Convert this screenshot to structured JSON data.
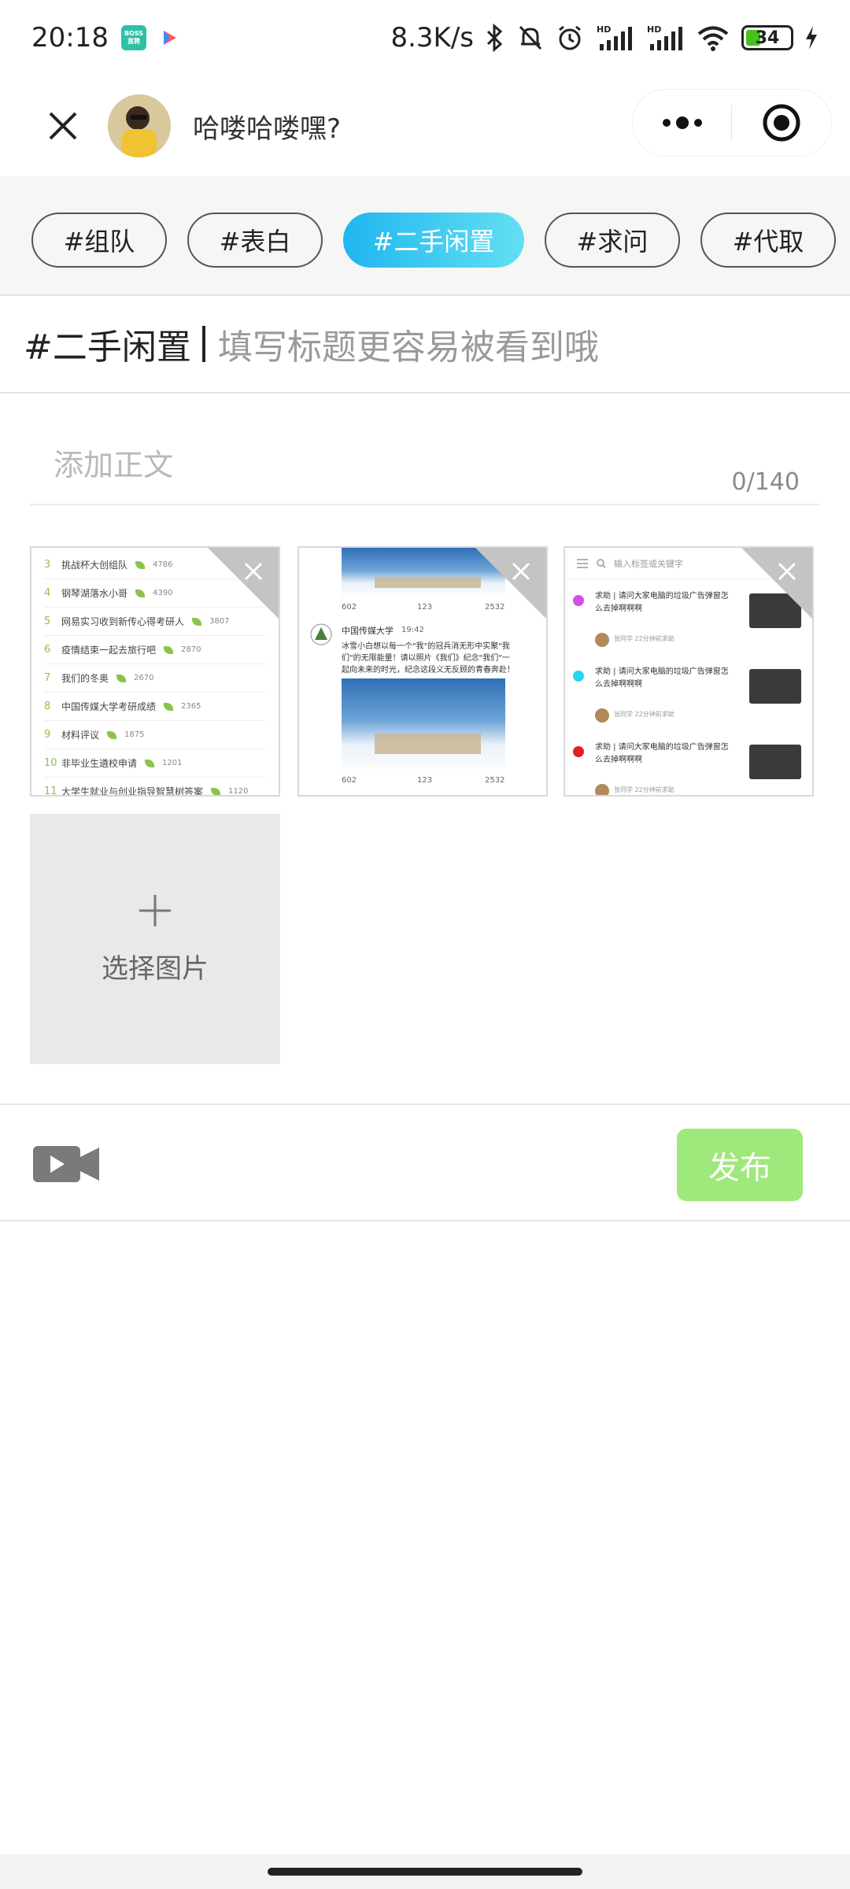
{
  "status_bar": {
    "time": "20:18",
    "boss_badge_top": "BOSS",
    "boss_badge_bottom": "直聘",
    "net_speed": "8.3K/s",
    "battery": "34",
    "icons": [
      "boss-app-icon",
      "play-icon",
      "bluetooth-icon",
      "mute-bell-icon",
      "alarm-icon",
      "hd-signal-icon",
      "hd-signal-icon",
      "wifi-icon",
      "battery-icon",
      "charging-icon"
    ]
  },
  "header": {
    "title": "哈喽哈喽嘿?"
  },
  "tags": [
    {
      "label": "#组队",
      "active": false
    },
    {
      "label": "#表白",
      "active": false
    },
    {
      "label": "#二手闲置",
      "active": true
    },
    {
      "label": "#求问",
      "active": false
    },
    {
      "label": "#代取",
      "active": false
    }
  ],
  "title_input": {
    "tag": "#二手闲置",
    "placeholder": "填写标题更容易被看到哦"
  },
  "body_input": {
    "placeholder": "添加正文",
    "counter": "0/140"
  },
  "images": {
    "image1": {
      "rows": [
        {
          "rank": "3",
          "text": "挑战杯大创组队",
          "count": "4786"
        },
        {
          "rank": "4",
          "text": "钢琴湖落水小哥",
          "count": "4390"
        },
        {
          "rank": "5",
          "text": "网易实习收到新传心得考研人",
          "count": "3807"
        },
        {
          "rank": "6",
          "text": "疫情结束一起去旅行吧",
          "count": "2870"
        },
        {
          "rank": "7",
          "text": "我们的冬奥",
          "count": "2670"
        },
        {
          "rank": "8",
          "text": "中国传媒大学考研成绩",
          "count": "2365"
        },
        {
          "rank": "9",
          "text": "材料评议",
          "count": "1875"
        },
        {
          "rank": "10",
          "text": "非毕业生遴校申请",
          "count": "1201"
        },
        {
          "rank": "11",
          "text": "大学生就业与创业指导智慧树答案",
          "count": "1120"
        }
      ]
    },
    "image2": {
      "share": "602",
      "comments": "123",
      "likes": "2532",
      "author": "中国传媒大学",
      "time": "19:42",
      "text": "冰雪小白想以每一个\"我\"的冠兵消无形中实聚\"我们\"的无限能量！请以照片《我们》纪念\"我们\"一起向未来的时光，纪念这段义无反顾的青春奔赴！"
    },
    "image3": {
      "search_placeholder": "输入标签或关键字",
      "items": [
        {
          "text": "求助 | 请问大家电脑的垃圾广告弹窗怎么去掉啊啊啊",
          "meta": "张同学 22分钟前求助"
        },
        {
          "text": "求助 | 请问大家电脑的垃圾广告弹窗怎么去掉啊啊啊",
          "meta": "张同学 22分钟前求助"
        },
        {
          "text": "求助 | 请问大家电脑的垃圾广告弹窗怎么去掉啊啊啊",
          "meta": "张同学 22分钟前求助"
        }
      ]
    },
    "add_label": "选择图片"
  },
  "bottom_bar": {
    "publish_label": "发布"
  },
  "colors": {
    "active_tag_start": "#1fb6f0",
    "active_tag_end": "#63dff2",
    "publish_bg": "#9fe87c",
    "add_image_bg": "#e9e9e9"
  }
}
